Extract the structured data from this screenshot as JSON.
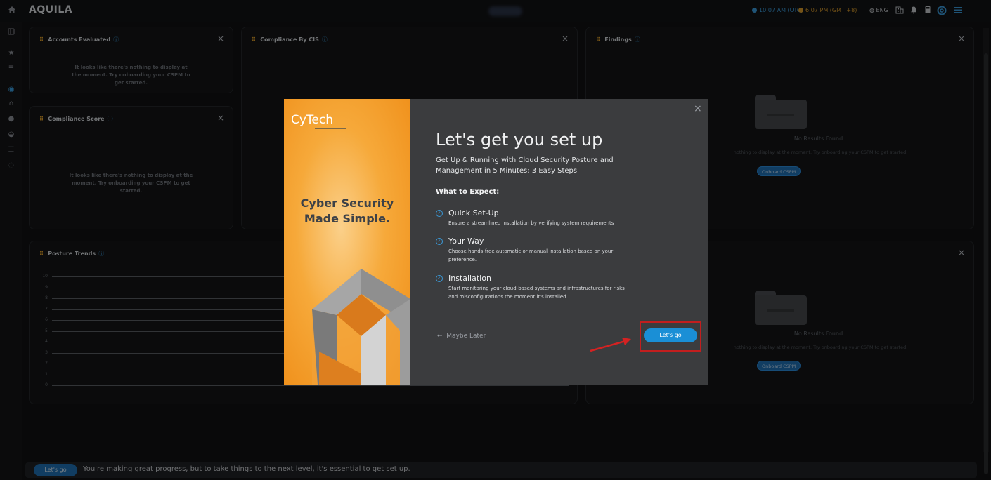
{
  "app": {
    "brand": "AQUILA"
  },
  "header": {
    "time_utc": "10:07 AM (UTC)",
    "time_local": "6:07 PM (GMT +8)",
    "language": "ENG",
    "icons": [
      "home-icon",
      "globe-icon",
      "building-icon",
      "bell-icon",
      "calculator-icon",
      "lifebuoy-icon",
      "menu-icon"
    ]
  },
  "sidebar": {
    "icons": [
      "panel-icon",
      "star-icon",
      "list-icon",
      "compass-icon",
      "bank-icon",
      "shield-icon",
      "cloud-icon",
      "database-icon",
      "shield-outline-icon"
    ]
  },
  "cards": {
    "accounts": {
      "title": "Accounts Evaluated",
      "empty": "It looks like there's nothing to display at the moment. Try onboarding your CSPM to get started."
    },
    "compliance_cis": {
      "title": "Compliance By CIS"
    },
    "findings": {
      "title": "Findings",
      "no_results": "No Results Found",
      "sub": "nothing to display at the moment. Try onboarding your CSPM to get started.",
      "button": "Onboard CSPM"
    },
    "compliance_score": {
      "title": "Compliance Score",
      "empty": "It looks like there's nothing to display at the moment. Try onboarding your CSPM to get started."
    },
    "posture_trends": {
      "title": "Posture Trends",
      "y_ticks": [
        "10",
        "9",
        "8",
        "7",
        "6",
        "5",
        "4",
        "3",
        "2",
        "1",
        "0"
      ]
    },
    "lower_right": {
      "no_results": "No Results Found",
      "sub": "nothing to display at the moment. Try onboarding your CSPM to get started.",
      "button": "Onboard CSPM"
    },
    "close_symbol": "×",
    "info_symbol": "ⓘ"
  },
  "modal": {
    "logo": "CyTech",
    "tagline_line1": "Cyber Security",
    "tagline_line2": "Made Simple.",
    "title": "Let's get you set up",
    "subtitle": "Get Up & Running with Cloud Security Posture and Management in 5 Minutes: 3 Easy Steps",
    "expect_heading": "What to Expect:",
    "steps": [
      {
        "title": "Quick Set-Up",
        "desc": "Ensure a streamlined installation by verifying system requirements"
      },
      {
        "title": "Your Way",
        "desc": "Choose hands-free automatic or manual installation based on your preference."
      },
      {
        "title": "Installation",
        "desc": "Start monitoring your cloud-based systems and infrastructures for risks and misconfigurations the moment it's installed."
      }
    ],
    "maybe_later": "Maybe Later",
    "lets_go": "Let's go",
    "close_symbol": "×"
  },
  "bottom_bar": {
    "button": "Let's go",
    "message": "You're making great progress, but to take things to the next level, it's essential to get set up."
  },
  "colors": {
    "accent_blue": "#1a8fd6",
    "brand_orange": "#f6a93a",
    "highlight_red": "#c21e1e"
  }
}
